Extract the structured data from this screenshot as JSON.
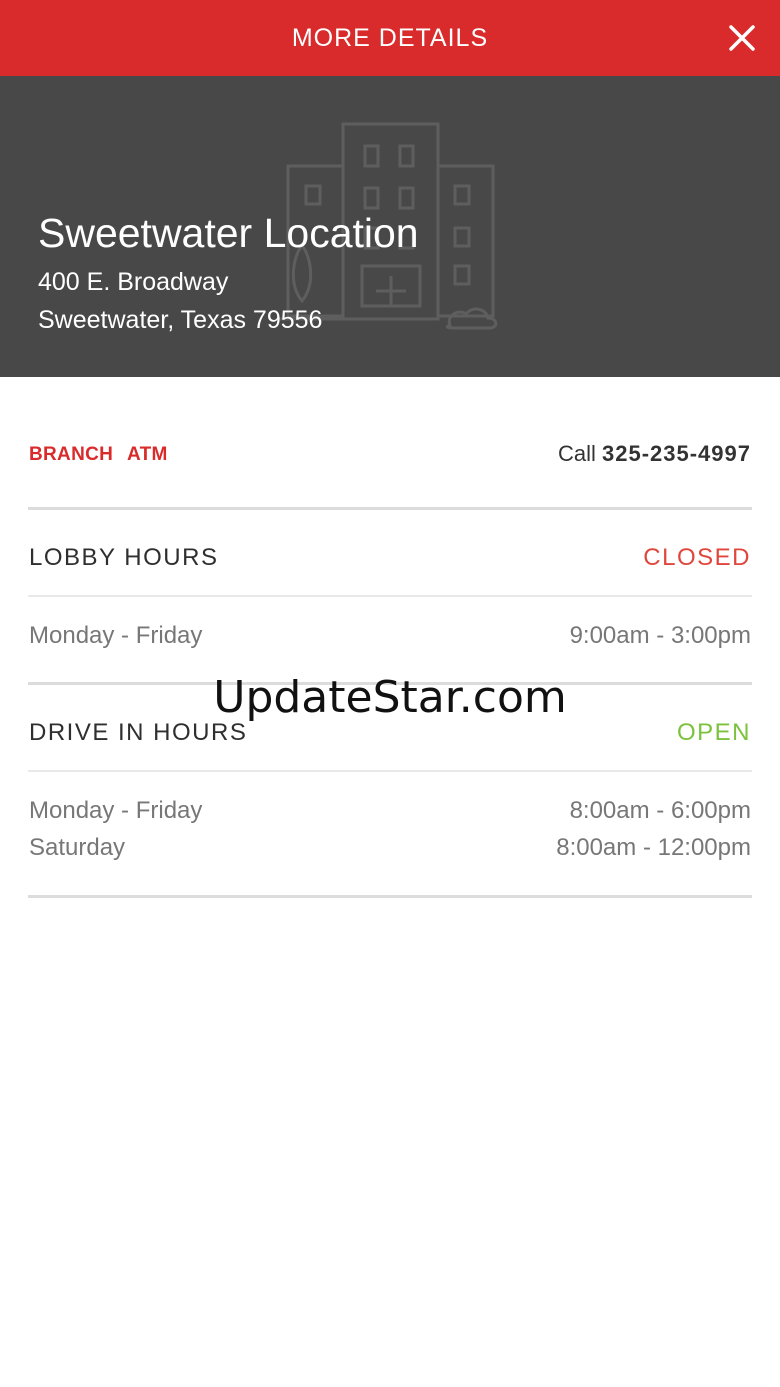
{
  "header": {
    "title": "MORE DETAILS",
    "close_icon": "close-icon"
  },
  "location": {
    "name": "Sweetwater Location",
    "address_line1": "400 E. Broadway",
    "address_line2": "Sweetwater, Texas 79556",
    "illustration_icon": "building-icon"
  },
  "tabs": {
    "branch": "BRANCH",
    "atm": "ATM"
  },
  "call": {
    "label": "Call",
    "number": "325-235-4997"
  },
  "lobby": {
    "title": "LOBBY HOURS",
    "status": "CLOSED",
    "rows": [
      {
        "days": "Monday - Friday",
        "hours": "9:00am - 3:00pm"
      }
    ]
  },
  "drive_in": {
    "title": "DRIVE IN HOURS",
    "status": "OPEN",
    "rows": [
      {
        "days": "Monday - Friday",
        "hours": "8:00am - 6:00pm"
      },
      {
        "days": "Saturday",
        "hours": "8:00am - 12:00pm"
      }
    ]
  },
  "watermark": "UpdateStar.com",
  "colors": {
    "brand_red": "#d92b2b",
    "hero_bg": "#484848",
    "closed": "#e0463c",
    "open": "#7cc23c"
  }
}
